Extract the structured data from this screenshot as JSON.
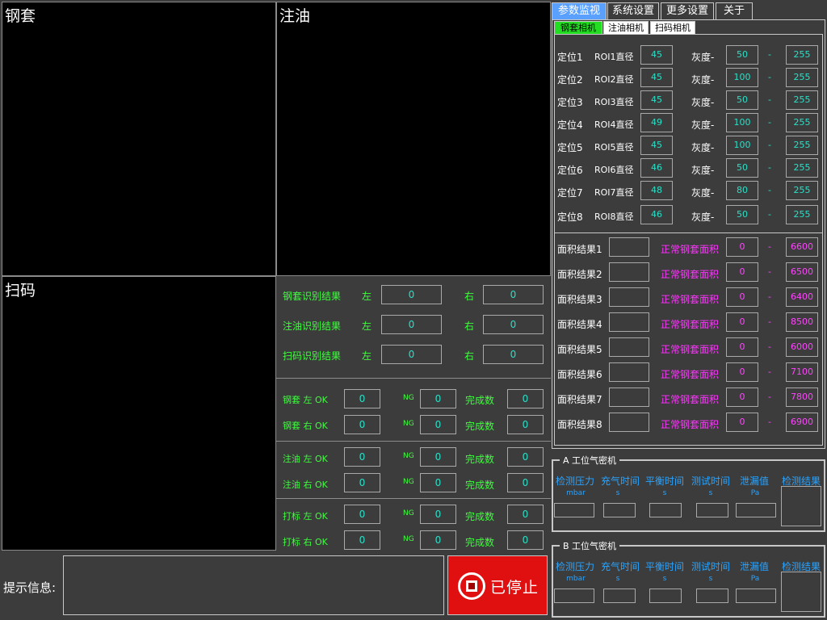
{
  "views": {
    "steel": "钢套",
    "oil": "注油",
    "scan": "扫码"
  },
  "recognition": {
    "left": "左",
    "right": "右",
    "rows": [
      {
        "label": "钢套识别结果",
        "left": "0",
        "right": "0"
      },
      {
        "label": "注油识别结果",
        "left": "0",
        "right": "0"
      },
      {
        "label": "扫码识别结果",
        "left": "0",
        "right": "0"
      }
    ]
  },
  "counters": {
    "ng": "NG",
    "done": "完成数",
    "rows": [
      {
        "label": "钢套 左 OK",
        "ok": "0",
        "ng": "0",
        "done": "0"
      },
      {
        "label": "钢套 右 OK",
        "ok": "0",
        "ng": "0",
        "done": "0"
      },
      {
        "label": "注油 左 OK",
        "ok": "0",
        "ng": "0",
        "done": "0"
      },
      {
        "label": "注油 右 OK",
        "ok": "0",
        "ng": "0",
        "done": "0"
      },
      {
        "label": "打标 左 OK",
        "ok": "0",
        "ng": "0",
        "done": "0"
      },
      {
        "label": "打标 右 OK",
        "ok": "0",
        "ng": "0",
        "done": "0"
      }
    ]
  },
  "hint": {
    "label": "提示信息:"
  },
  "stop": {
    "label": "已停止",
    "color": "#e01010"
  },
  "tabs": [
    "参数监视",
    "系统设置",
    "更多设置",
    "关于"
  ],
  "subtabs": [
    "钢套相机",
    "注油相机",
    "扫码相机"
  ],
  "roi": {
    "gray_label": "灰度-",
    "dash": "-",
    "rows": [
      {
        "pos": "定位1",
        "roi": "ROI1直径",
        "dia": "45",
        "gmin": "50",
        "gmax": "255"
      },
      {
        "pos": "定位2",
        "roi": "ROI2直径",
        "dia": "45",
        "gmin": "100",
        "gmax": "255"
      },
      {
        "pos": "定位3",
        "roi": "ROI3直径",
        "dia": "45",
        "gmin": "50",
        "gmax": "255"
      },
      {
        "pos": "定位4",
        "roi": "ROI4直径",
        "dia": "49",
        "gmin": "100",
        "gmax": "255"
      },
      {
        "pos": "定位5",
        "roi": "ROI5直径",
        "dia": "45",
        "gmin": "100",
        "gmax": "255"
      },
      {
        "pos": "定位6",
        "roi": "ROI6直径",
        "dia": "46",
        "gmin": "50",
        "gmax": "255"
      },
      {
        "pos": "定位7",
        "roi": "ROI7直径",
        "dia": "48",
        "gmin": "80",
        "gmax": "255"
      },
      {
        "pos": "定位8",
        "roi": "ROI8直径",
        "dia": "46",
        "gmin": "50",
        "gmax": "255"
      }
    ]
  },
  "area": {
    "normal_label": "正常钢套面积",
    "dash": "-",
    "rows": [
      {
        "label": "面积结果1",
        "value": "",
        "min": "0",
        "max": "6600"
      },
      {
        "label": "面积结果2",
        "value": "",
        "min": "0",
        "max": "6500"
      },
      {
        "label": "面积结果3",
        "value": "",
        "min": "0",
        "max": "6400"
      },
      {
        "label": "面积结果4",
        "value": "",
        "min": "0",
        "max": "8500"
      },
      {
        "label": "面积结果5",
        "value": "",
        "min": "0",
        "max": "6000"
      },
      {
        "label": "面积结果6",
        "value": "",
        "min": "0",
        "max": "7100"
      },
      {
        "label": "面积结果7",
        "value": "",
        "min": "0",
        "max": "7800"
      },
      {
        "label": "面积结果8",
        "value": "",
        "min": "0",
        "max": "6900"
      }
    ]
  },
  "airtight": {
    "a_title": "A 工位气密机",
    "b_title": "B 工位气密机",
    "cols": [
      {
        "label": "检测压力",
        "unit": "mbar"
      },
      {
        "label": "充气时间",
        "unit": "s"
      },
      {
        "label": "平衡时间",
        "unit": "s"
      },
      {
        "label": "测试时间",
        "unit": "s"
      },
      {
        "label": "泄漏值",
        "unit": "Pa"
      }
    ],
    "result_label": "检测结果"
  }
}
